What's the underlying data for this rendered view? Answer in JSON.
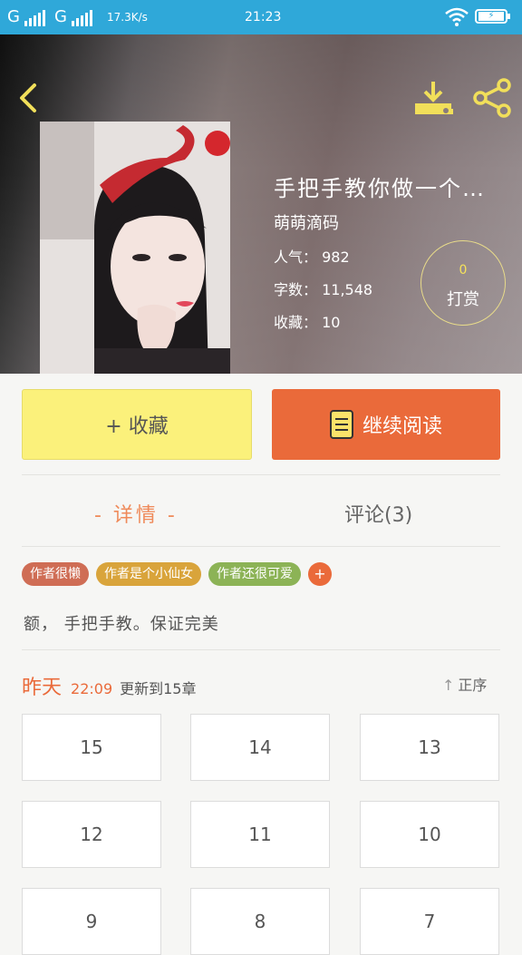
{
  "status": {
    "sig1": "G",
    "sig2": "G",
    "net": "17.3K/s",
    "time": "21:23",
    "battery": "⚡"
  },
  "book": {
    "title": "手把手教你做一个…",
    "author": "萌萌滴码",
    "popularity": "人气： 982",
    "wordcount": "字数： 11,548",
    "favorites": "收藏： 10",
    "tip_count": "0",
    "tip_label": "打赏"
  },
  "actions": {
    "favorite": "+ 收藏",
    "read": "继续阅读"
  },
  "tabs": {
    "detail": "- 详情 -",
    "comments": "评论(3)"
  },
  "tags": [
    {
      "label": "作者很懒",
      "color": "#cf6d55"
    },
    {
      "label": "作者是个小仙女",
      "color": "#d9a43b"
    },
    {
      "label": "作者还很可爱",
      "color": "#8cb356"
    },
    {
      "label": "+",
      "color": "#ea6a3a"
    }
  ],
  "description": "额， 手把手教。保证完美",
  "update": {
    "day": "昨天",
    "time": "22:09",
    "text": "更新到15章",
    "order": "正序"
  },
  "chapters": [
    "15",
    "14",
    "13",
    "12",
    "11",
    "10",
    "9",
    "8",
    "7"
  ]
}
